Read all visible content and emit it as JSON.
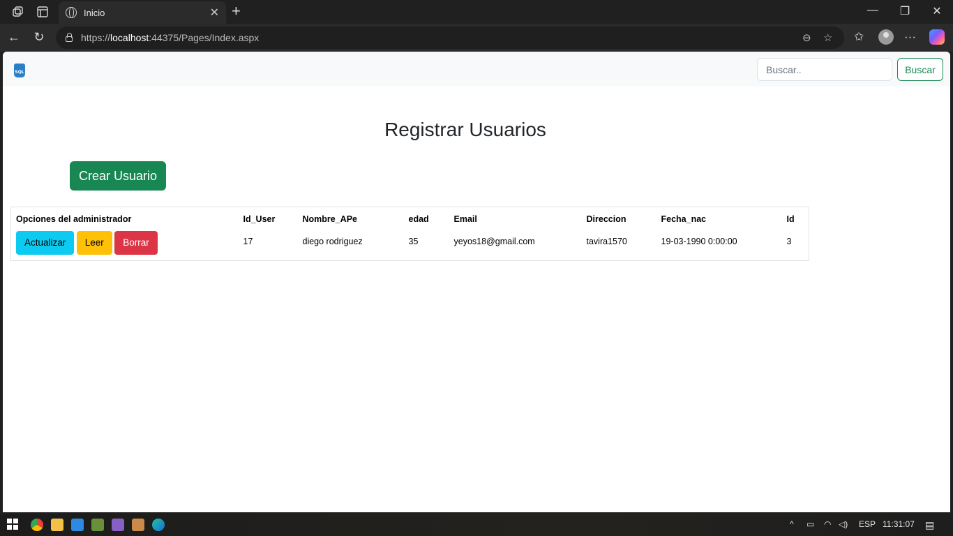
{
  "browser": {
    "tab_title": "Inicio",
    "url_prefix": "https://",
    "url_host": "localhost",
    "url_rest": ":44375/Pages/Index.aspx"
  },
  "navbar": {
    "brand_text": "SQL",
    "search_placeholder": "Buscar..",
    "search_button": "Buscar"
  },
  "main": {
    "title": "Registrar Usuarios",
    "create_button": "Crear Usuario"
  },
  "table": {
    "headers": [
      "Opciones del administrador",
      "Id_User",
      "Nombre_APe",
      "edad",
      "Email",
      "Direccion",
      "Fecha_nac",
      "Id"
    ],
    "rows": [
      {
        "actions": [
          "Actualizar",
          "Leer",
          "Borrar"
        ],
        "id_user": "17",
        "nombre": "diego rodriguez",
        "edad": "35",
        "email": "yeyos18@gmail.com",
        "direccion": "tavira1570",
        "fecha_nac": "19-03-1990 0:00:00",
        "id": "3"
      }
    ]
  },
  "taskbar": {
    "lang": "ESP",
    "time": "11:31:07"
  },
  "colors": {
    "success": "#198754",
    "info": "#0dcaf0",
    "warning": "#ffc107",
    "danger": "#dc3545"
  }
}
